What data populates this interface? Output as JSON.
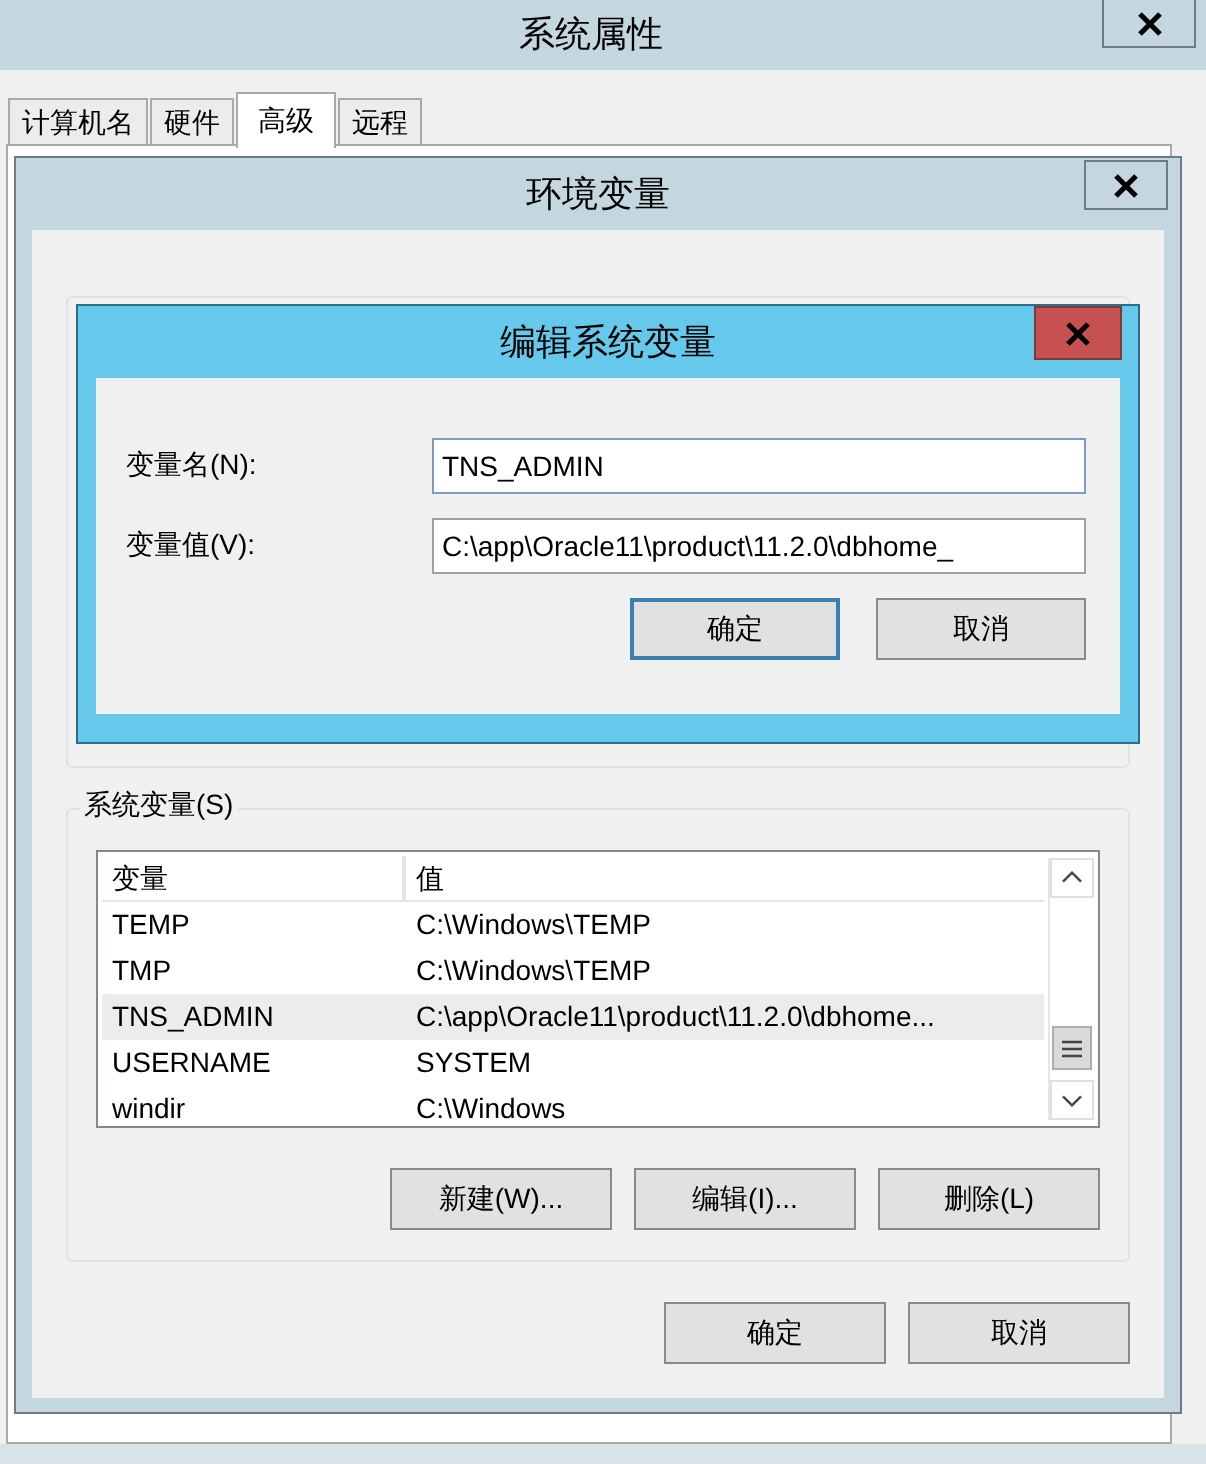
{
  "system_properties": {
    "title": "系统属性",
    "tabs": [
      {
        "label": "计算机名",
        "selected": false
      },
      {
        "label": "硬件",
        "selected": false
      },
      {
        "label": "高级",
        "selected": true
      },
      {
        "label": "远程",
        "selected": false
      }
    ]
  },
  "environment_variables": {
    "title": "环境变量",
    "system_group": {
      "label": "系统变量(S)",
      "columns": [
        "变量",
        "值"
      ],
      "rows": [
        {
          "name": "TEMP",
          "value": "C:\\Windows\\TEMP",
          "selected": false
        },
        {
          "name": "TMP",
          "value": "C:\\Windows\\TEMP",
          "selected": false
        },
        {
          "name": "TNS_ADMIN",
          "value": "C:\\app\\Oracle11\\product\\11.2.0\\dbhome...",
          "selected": true
        },
        {
          "name": "USERNAME",
          "value": "SYSTEM",
          "selected": false
        },
        {
          "name": "windir",
          "value": "C:\\Windows",
          "selected": false
        }
      ],
      "buttons": [
        "新建(W)...",
        "编辑(I)...",
        "删除(L)"
      ]
    },
    "buttons": [
      "确定",
      "取消"
    ]
  },
  "edit_dialog": {
    "title": "编辑系统变量",
    "fields": [
      {
        "label": "变量名(N):",
        "value": "TNS_ADMIN"
      },
      {
        "label": "变量值(V):",
        "value": "C:\\app\\Oracle11\\product\\11.2.0\\dbhome_"
      }
    ],
    "buttons": [
      {
        "label": "确定",
        "default": true
      },
      {
        "label": "取消",
        "default": false
      }
    ]
  }
}
